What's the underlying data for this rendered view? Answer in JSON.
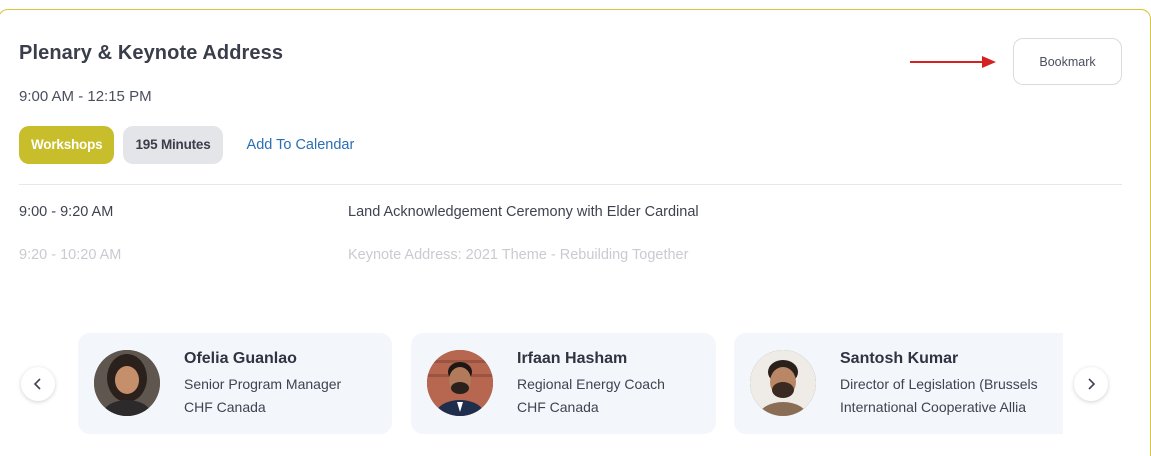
{
  "session": {
    "title": "Plenary & Keynote Address",
    "time": "9:00 AM - 12:15 PM",
    "tags": [
      "Workshops",
      "195 Minutes"
    ],
    "add_to_calendar": "Add To Calendar",
    "bookmark_label": "Bookmark"
  },
  "agenda": [
    {
      "time": "9:00 - 9:20 AM",
      "title": "Land Acknowledgement Ceremony with Elder Cardinal"
    },
    {
      "time": "9:20  - 10:20 AM",
      "title": "Keynote Address: 2021 Theme - Rebuilding Together"
    }
  ],
  "speakers": [
    {
      "name": "Ofelia Guanlao",
      "role": "Senior Program Manager",
      "org": "CHF Canada"
    },
    {
      "name": "Irfaan Hasham",
      "role": "Regional Energy Coach",
      "org": "CHF Canada"
    },
    {
      "name": "Santosh Kumar",
      "role": "Director of Legislation (Brussels",
      "org": "International Cooperative Allia"
    }
  ],
  "colors": {
    "border": "#d6c53f",
    "tag_primary": "#c8bd2a",
    "link": "#2a6fb3",
    "arrow": "#d22222"
  }
}
